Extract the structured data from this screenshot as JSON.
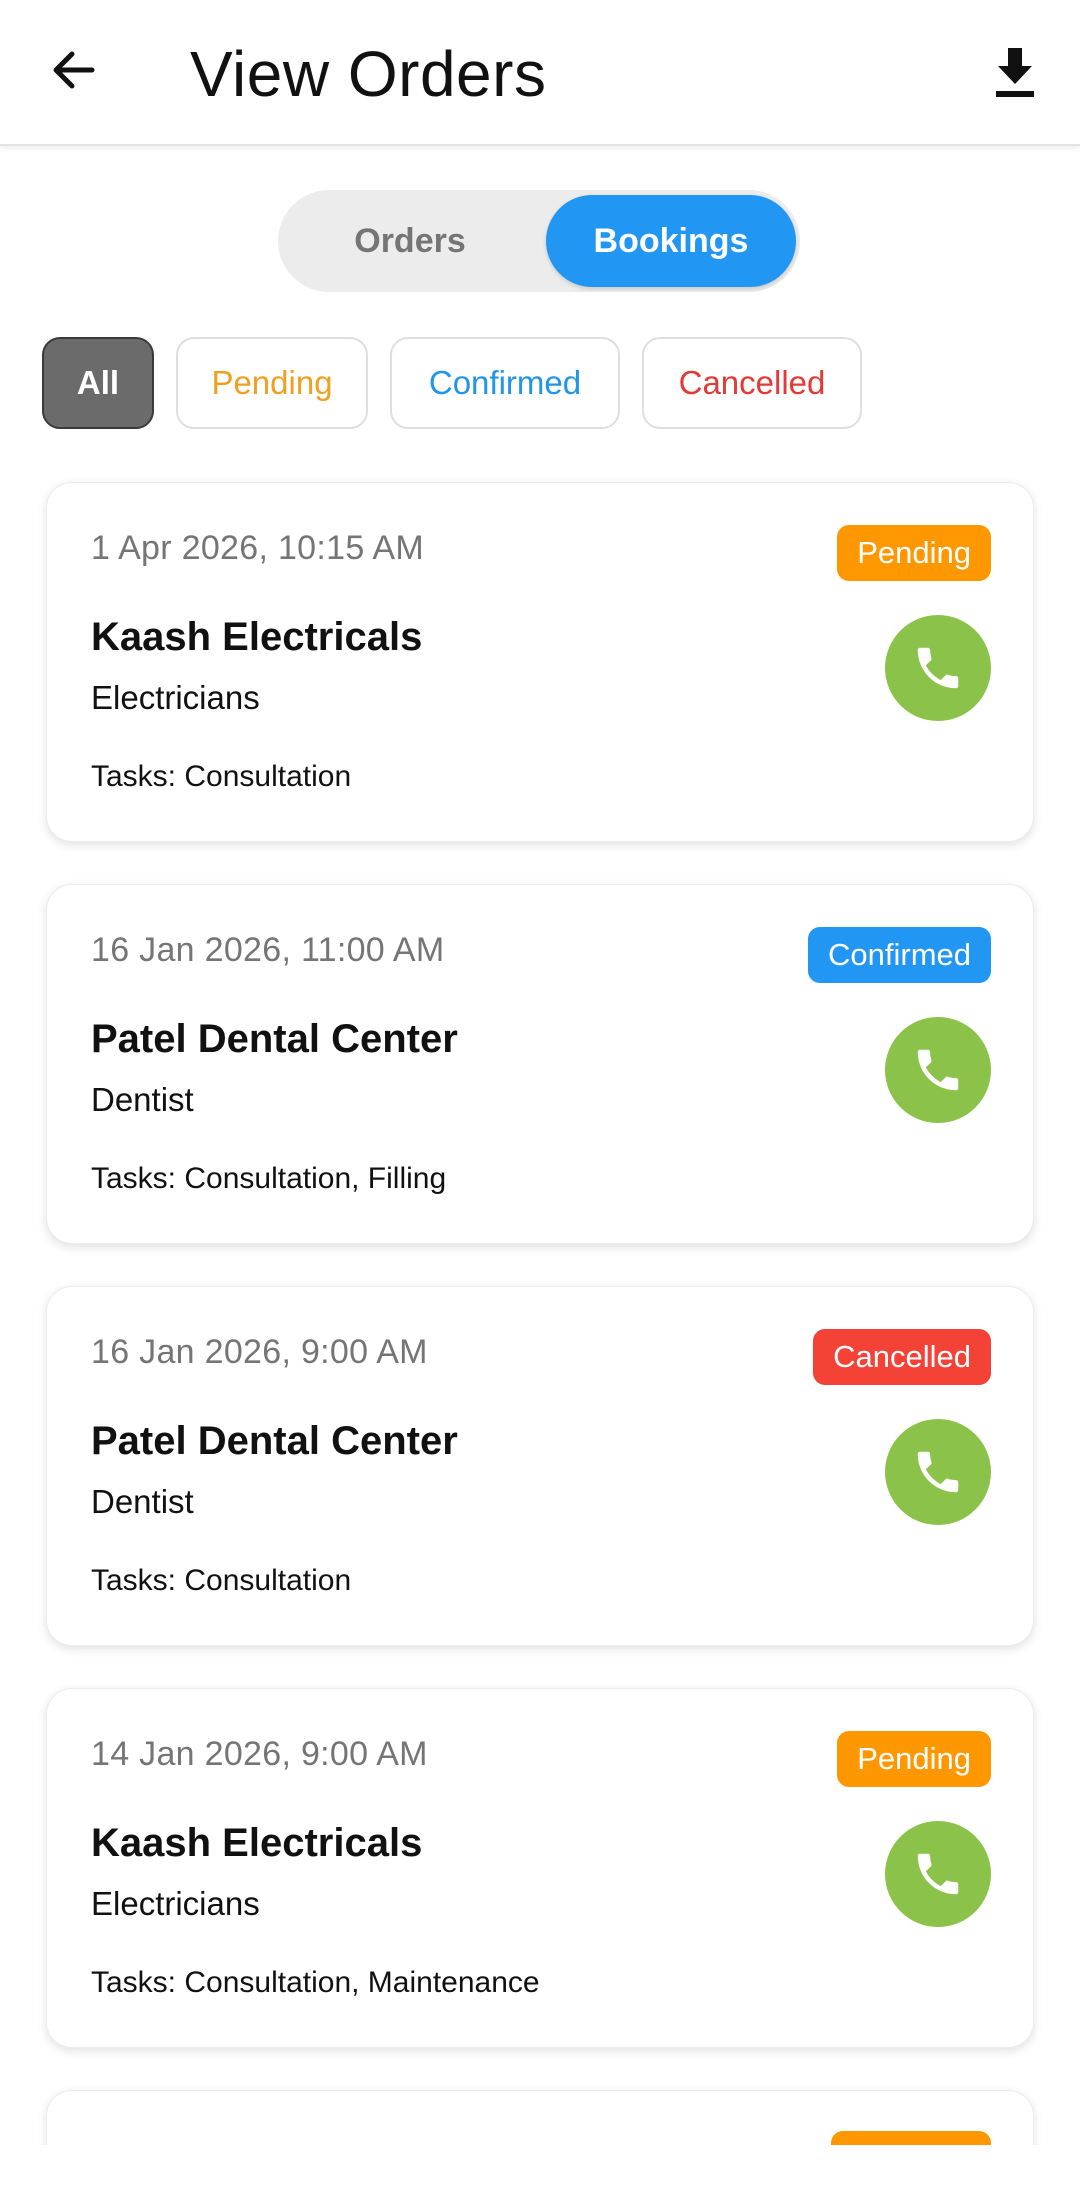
{
  "header": {
    "title": "View Orders",
    "back_icon": "arrow-left-icon",
    "download_icon": "download-icon"
  },
  "segment": {
    "orders": "Orders",
    "bookings": "Bookings",
    "selected": "Bookings"
  },
  "filters": {
    "all": "All",
    "pending": "Pending",
    "confirmed": "Confirmed",
    "cancelled": "Cancelled",
    "selected": "All"
  },
  "colors": {
    "accent": "#2196f3",
    "pending": "#ff9800",
    "confirmed": "#2196f3",
    "cancelled": "#f44336",
    "call": "#8bc34a"
  },
  "bookings": [
    {
      "date": "1 Apr 2026, 10:15 AM",
      "status": "Pending",
      "name": "Kaash Electricals",
      "category": "Electricians",
      "tasks": "Tasks: Consultation"
    },
    {
      "date": "16 Jan 2026, 11:00 AM",
      "status": "Confirmed",
      "name": "Patel Dental Center",
      "category": "Dentist",
      "tasks": "Tasks: Consultation, Filling"
    },
    {
      "date": "16 Jan 2026, 9:00 AM",
      "status": "Cancelled",
      "name": "Patel Dental Center",
      "category": "Dentist",
      "tasks": "Tasks: Consultation"
    },
    {
      "date": "14 Jan 2026, 9:00 AM",
      "status": "Pending",
      "name": "Kaash Electricals",
      "category": "Electricians",
      "tasks": "Tasks: Consultation, Maintenance"
    }
  ]
}
